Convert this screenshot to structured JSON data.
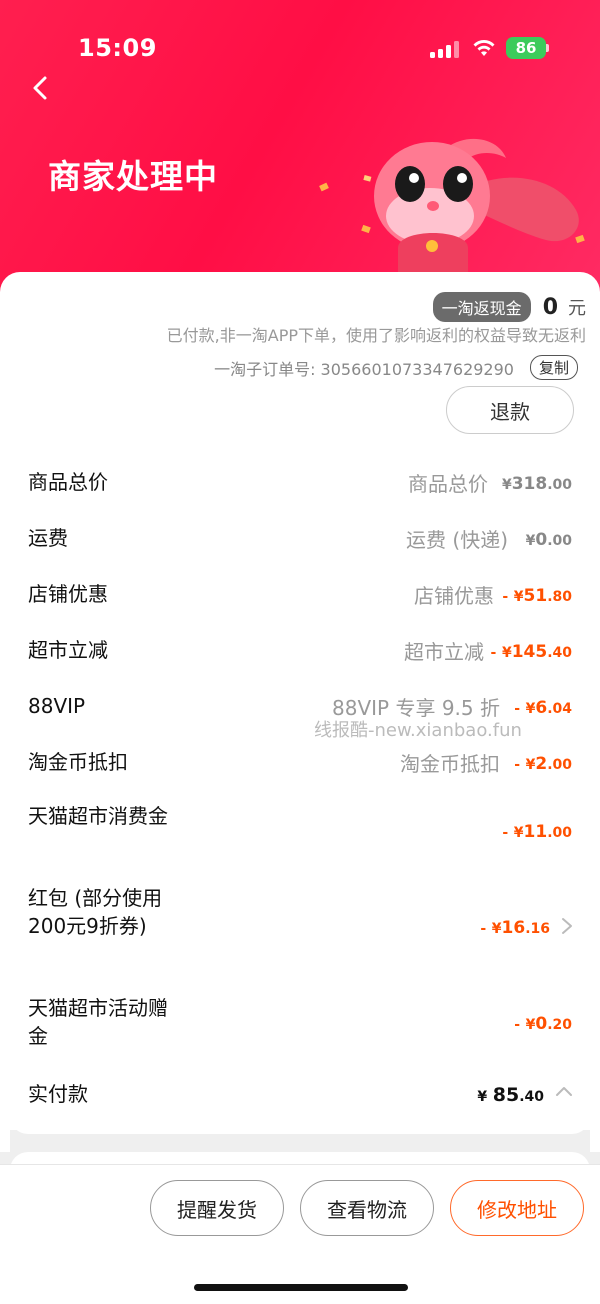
{
  "status_bar": {
    "time": "15:09",
    "battery": "86"
  },
  "header": {
    "title": "商家处理中"
  },
  "rebate": {
    "badge": "一淘返现金",
    "amount": "0",
    "unit": "元",
    "note": "已付款,非一淘APP下单，使用了影响返利的权益导致无返利"
  },
  "suborder": {
    "label": "一淘子订单号: 3056601073347629290",
    "copy_label": "复制"
  },
  "refund_label": "退款",
  "price_rows": [
    {
      "label": "商品总价",
      "desc": "商品总价",
      "sign": "",
      "yuan": "318",
      "fen": ".00"
    },
    {
      "label": "运费",
      "desc": "运费 (快递)",
      "sign": "",
      "yuan": "0",
      "fen": ".00"
    },
    {
      "label": "店铺优惠",
      "desc": "店铺优惠",
      "sign": "-",
      "yuan": "51",
      "fen": ".80"
    },
    {
      "label": "超市立减",
      "desc": "超市立减",
      "sign": "-",
      "yuan": "145",
      "fen": ".40"
    },
    {
      "label": "88VIP",
      "desc": "88VIP 专享 9.5 折",
      "sign": "-",
      "yuan": "6",
      "fen": ".04"
    },
    {
      "label": "淘金币抵扣",
      "desc": "淘金币抵扣",
      "sign": "-",
      "yuan": "2",
      "fen": ".00"
    },
    {
      "label": "天猫超市消费金",
      "desc": "",
      "sign": "-",
      "yuan": "11",
      "fen": ".00"
    },
    {
      "label": "红包 (部分使用200元9折券)",
      "desc": "",
      "sign": "-",
      "yuan": "16",
      "fen": ".16"
    },
    {
      "label": "天猫超市活动赠金",
      "desc": "",
      "sign": "-",
      "yuan": "0",
      "fen": ".20"
    }
  ],
  "total": {
    "label": "实付款",
    "yuan": "85",
    "fen": ".40"
  },
  "currency": "¥",
  "watermark": "线报酷-new.xianbao.fun",
  "actions": {
    "remind": "提醒发货",
    "logistics": "查看物流",
    "modify_address": "修改地址"
  },
  "colors": {
    "brand_red": "#ff1f4f",
    "discount_orange": "#ff5000"
  }
}
